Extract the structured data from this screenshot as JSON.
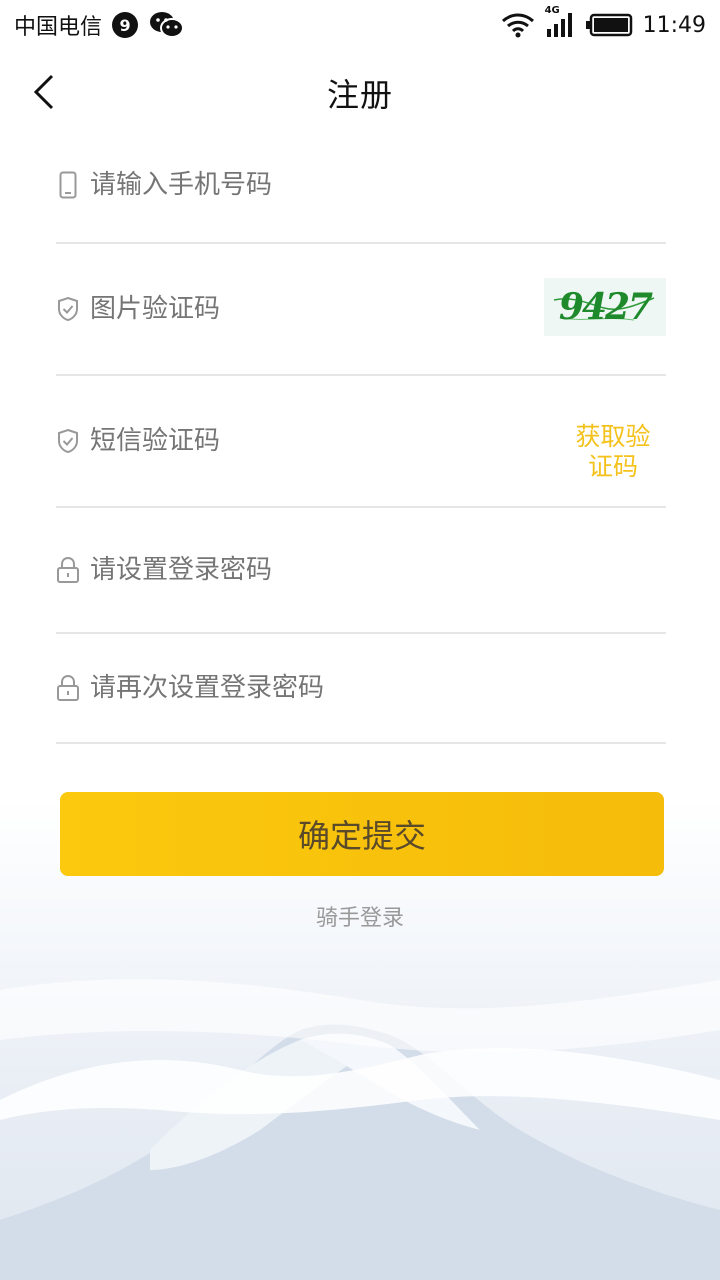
{
  "status_bar": {
    "carrier": "中国电信",
    "notification_count": "9",
    "network_type": "4G",
    "time": "11:49"
  },
  "header": {
    "title": "注册"
  },
  "form": {
    "phone_placeholder": "请输入手机号码",
    "captcha_placeholder": "图片验证码",
    "captcha_code": "9427",
    "sms_placeholder": "短信验证码",
    "sms_button_label": "获取验证码",
    "password_placeholder": "请设置登录密码",
    "password_confirm_placeholder": "请再次设置登录密码"
  },
  "actions": {
    "submit_label": "确定提交",
    "rider_login_label": "骑手登录"
  },
  "colors": {
    "accent": "#fcc90e",
    "sms_button_text": "#f4c21a",
    "captcha_text": "#1f8a2b"
  },
  "icons": [
    "wechat-icon",
    "wifi-icon",
    "signal-icon",
    "battery-icon",
    "back-arrow-icon",
    "phone-icon",
    "shield-check-icon",
    "lock-icon"
  ]
}
